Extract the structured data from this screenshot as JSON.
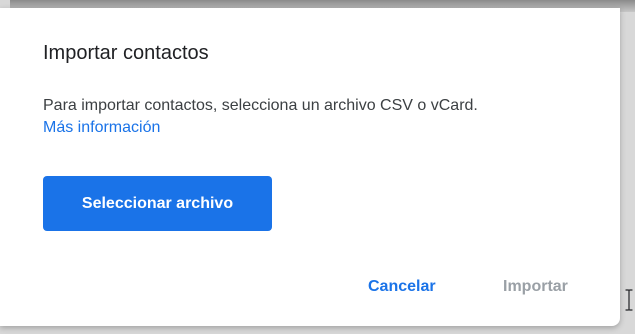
{
  "dialog": {
    "title": "Importar contactos",
    "description": "Para importar contactos, selecciona un archivo CSV o vCard.",
    "learn_more": "Más información",
    "select_file_label": "Seleccionar archivo",
    "cancel_label": "Cancelar",
    "import_label": "Importar"
  },
  "icons": {
    "cursor": "text-cursor-icon"
  },
  "colors": {
    "accent": "#1a73e8",
    "disabled": "#9aa0a6"
  }
}
